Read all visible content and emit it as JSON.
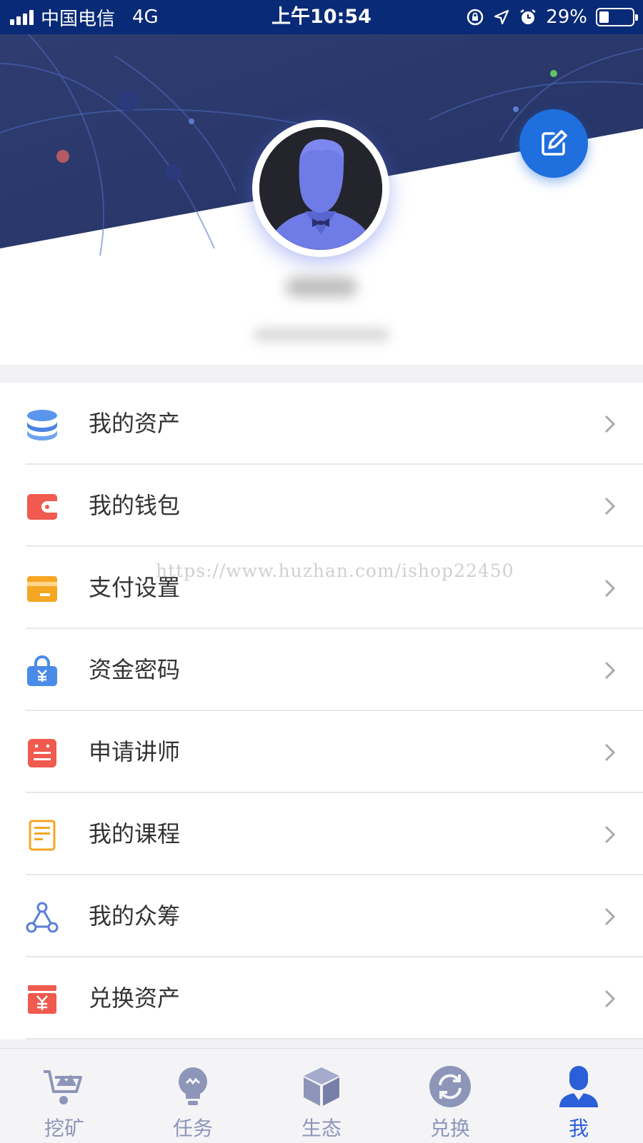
{
  "status_bar": {
    "carrier": "中国电信",
    "network": "4G",
    "time": "上午10:54",
    "battery": "29%",
    "battery_level": 0.29
  },
  "colors": {
    "status_bar_bg": "#082a77",
    "banner": "#2c3a6f",
    "accent": "#1f6fde",
    "tab_active": "#2a5fd8",
    "tab_inactive": "#8d95b9"
  },
  "header": {
    "avatar": "avatar-silhouette-icon",
    "edit_icon": "edit-icon"
  },
  "menu": {
    "items": [
      {
        "label": "我的资产",
        "icon": "coins-stack-icon",
        "color": "#4a8be8"
      },
      {
        "label": "我的钱包",
        "icon": "wallet-icon",
        "color": "#f05a4f"
      },
      {
        "label": "支付设置",
        "icon": "card-icon",
        "color": "#f5a623"
      },
      {
        "label": "资金密码",
        "icon": "lock-yuan-icon",
        "color": "#4a8be8"
      },
      {
        "label": "申请讲师",
        "icon": "lecturer-icon",
        "color": "#f05a4f"
      },
      {
        "label": "我的课程",
        "icon": "course-book-icon",
        "color": "#f5a623"
      },
      {
        "label": "我的众筹",
        "icon": "crowdfunding-icon",
        "color": "#5b7fd8"
      },
      {
        "label": "兑换资产",
        "icon": "exchange-yuan-icon",
        "color": "#f05a4f"
      }
    ]
  },
  "watermark": "https://www.huzhan.com/ishop22450",
  "tab_bar": {
    "tabs": [
      {
        "label": "挖矿",
        "icon": "mining-cart-icon"
      },
      {
        "label": "任务",
        "icon": "task-bulb-icon"
      },
      {
        "label": "生态",
        "icon": "ecology-cube-icon"
      },
      {
        "label": "兑换",
        "icon": "exchange-refresh-icon"
      },
      {
        "label": "我",
        "icon": "profile-person-icon",
        "active": true
      }
    ]
  }
}
